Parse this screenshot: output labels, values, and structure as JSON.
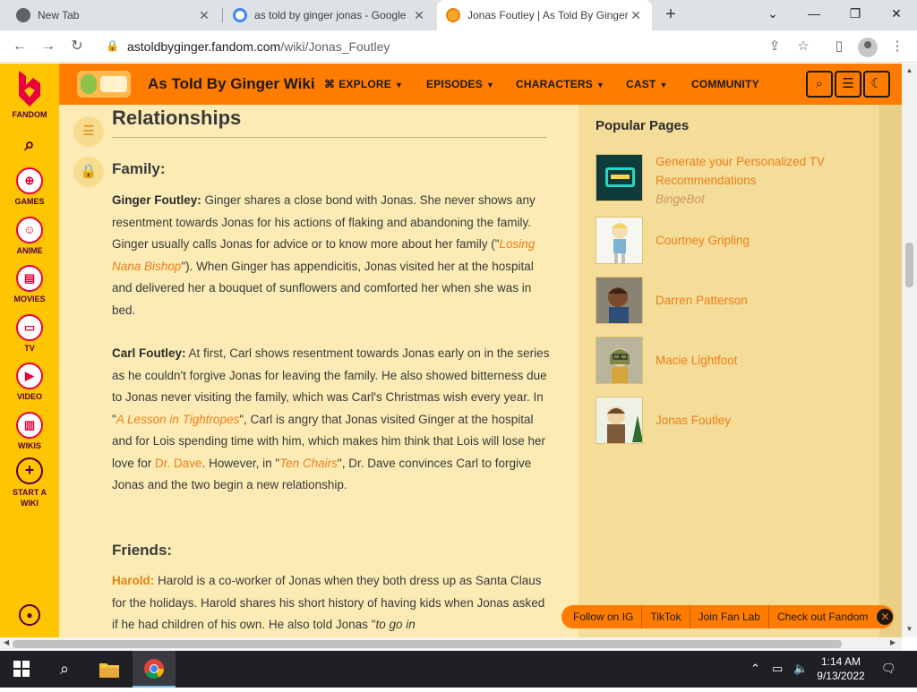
{
  "browser": {
    "tabs": [
      {
        "title": "New Tab"
      },
      {
        "title": "as told by ginger jonas - Google"
      },
      {
        "title": "Jonas Foutley | As Told By Ginger"
      }
    ],
    "url_host": "astoldbyginger.fandom.com",
    "url_path": "/wiki/Jonas_Foutley"
  },
  "rail": {
    "items": [
      {
        "label": "FANDOM"
      },
      {
        "label": "GAMES"
      },
      {
        "label": "ANIME"
      },
      {
        "label": "MOVIES"
      },
      {
        "label": "TV"
      },
      {
        "label": "VIDEO"
      },
      {
        "label": "WIKIS"
      },
      {
        "label": "START A WIKI"
      }
    ]
  },
  "header": {
    "wiki_name": "As Told By Ginger Wiki",
    "nav": [
      "EXPLORE",
      "EPISODES",
      "CHARACTERS",
      "CAST",
      "COMMUNITY"
    ]
  },
  "article": {
    "section_title": "Relationships",
    "family_heading": "Family:",
    "friends_heading": "Friends:",
    "ginger_name": "Ginger Foutley:",
    "ginger_text_1": " Ginger shares a close bond with Jonas. She never shows any resentment towards Jonas for his actions of flaking and abandoning the family. Ginger usually calls Jonas for advice or to know more about her family (\"",
    "ginger_link": "Losing Nana Bishop",
    "ginger_text_2": "\"). When Ginger has appendicitis, Jonas visited her at the hospital and delivered her a bouquet of sunflowers and comforted her when she was in bed.",
    "carl_name": "Carl Foutley:",
    "carl_text_1": " At first, Carl shows resentment towards Jonas early on in the series as he couldn't forgive Jonas for leaving the family. He also showed bitterness due to Jonas never visiting the family, which was Carl's Christmas wish every year. In \"",
    "carl_link_1": "A Lesson in Tightropes",
    "carl_text_2": "\", Carl is angry that Jonas visited Ginger at the hospital and for Lois spending time with him, which makes him think that Lois will lose her love for ",
    "carl_link_2": "Dr. Dave",
    "carl_text_3": ". However, in \"",
    "carl_link_3": "Ten Chairs",
    "carl_text_4": "\", Dr. Dave convinces Carl to forgive Jonas and the two begin a new relationship.",
    "harold_name": "Harold:",
    "harold_text_1": " Harold is a co-worker of Jonas when they both dress up as Santa Claus for the holidays. Harold shares his short history of having kids when Jonas asked if he had children of his own. He also told Jonas \"",
    "harold_quote": "to go in"
  },
  "popular": {
    "title": "Popular Pages",
    "items": [
      {
        "title": "Generate your Personalized TV Recommendations",
        "sub": "BingeBot"
      },
      {
        "title": "Courtney Gripling"
      },
      {
        "title": "Darren Patterson"
      },
      {
        "title": "Macie Lightfoot"
      },
      {
        "title": "Jonas Foutley"
      }
    ]
  },
  "social": [
    "Follow on IG",
    "TikTok",
    "Join Fan Lab",
    "Check out Fandom"
  ],
  "taskbar": {
    "time": "1:14 AM",
    "date": "9/13/2022"
  }
}
